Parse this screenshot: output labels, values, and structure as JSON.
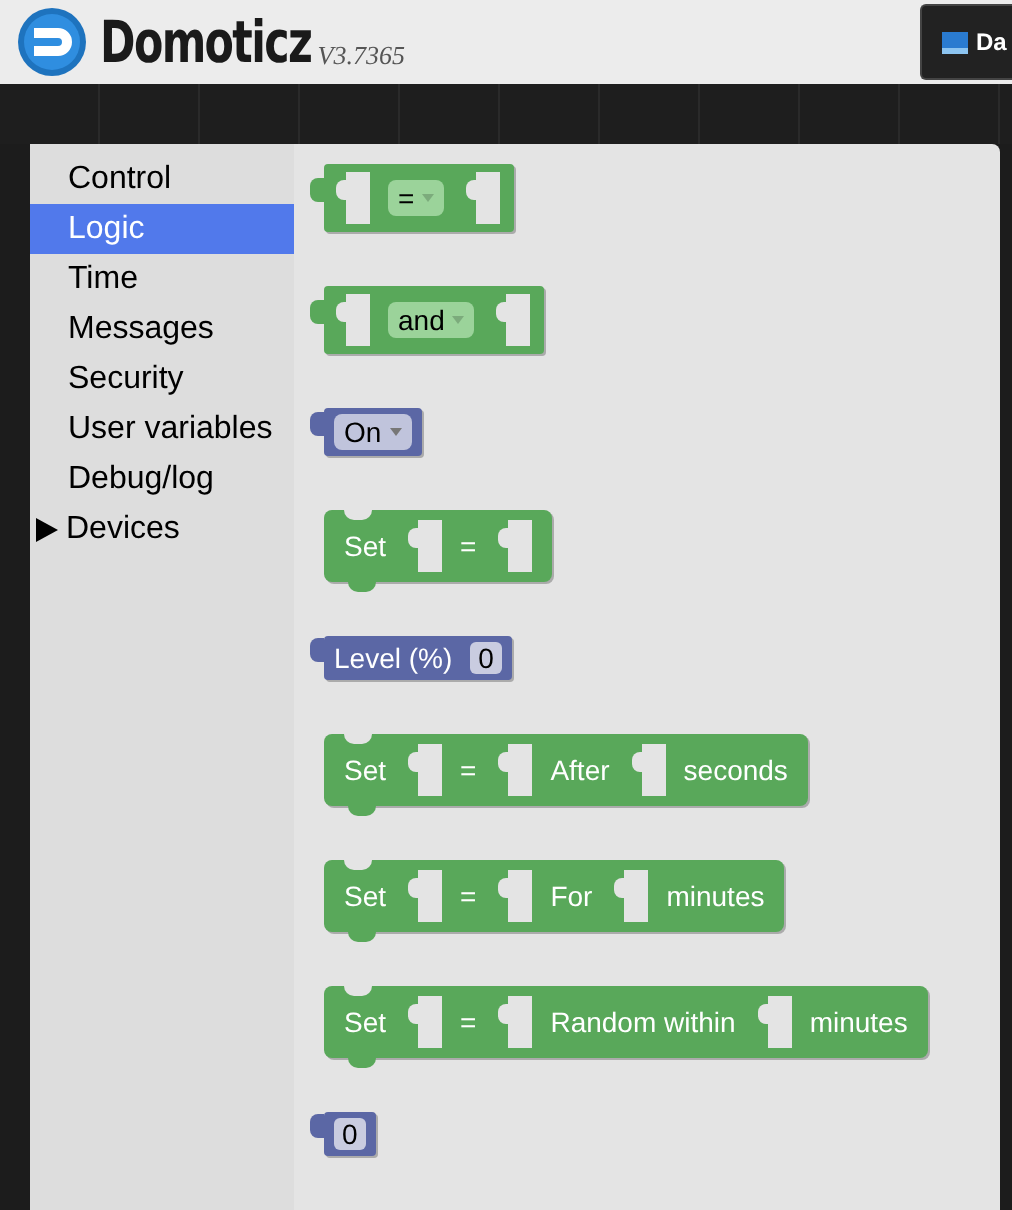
{
  "header": {
    "brand": "Domoticz",
    "version": "V3.7365",
    "nav_button": "Da"
  },
  "sidebar": {
    "items": [
      {
        "label": "Control",
        "selected": false,
        "kind": "category"
      },
      {
        "label": "Logic",
        "selected": true,
        "kind": "category"
      },
      {
        "label": "Time",
        "selected": false,
        "kind": "category"
      },
      {
        "label": "Messages",
        "selected": false,
        "kind": "category"
      },
      {
        "label": "Security",
        "selected": false,
        "kind": "category"
      },
      {
        "label": "User variables",
        "selected": false,
        "kind": "category"
      },
      {
        "label": "Debug/log",
        "selected": false,
        "kind": "category"
      },
      {
        "label": "Devices",
        "selected": false,
        "kind": "folder",
        "expanded": false
      }
    ]
  },
  "flyout": {
    "blocks": [
      {
        "kind": "value",
        "color": "#59a85a",
        "parts": [
          {
            "kind": "slot"
          },
          {
            "kind": "dropdown",
            "text": "="
          },
          {
            "kind": "slot"
          }
        ]
      },
      {
        "kind": "value",
        "color": "#59a85a",
        "parts": [
          {
            "kind": "slot"
          },
          {
            "kind": "dropdown",
            "text": "and"
          },
          {
            "kind": "slot"
          }
        ]
      },
      {
        "kind": "value",
        "color": "#5b67a5",
        "parts": [
          {
            "kind": "dropdown",
            "text": "On"
          }
        ]
      },
      {
        "kind": "statement",
        "color": "#59a85a",
        "parts": [
          {
            "kind": "text",
            "text": "Set"
          },
          {
            "kind": "slot"
          },
          {
            "kind": "text",
            "text": "="
          },
          {
            "kind": "slot"
          }
        ]
      },
      {
        "kind": "value",
        "color": "#5b67a5",
        "parts": [
          {
            "kind": "text",
            "text": "Level (%)"
          },
          {
            "kind": "number",
            "text": "0"
          }
        ]
      },
      {
        "kind": "statement",
        "color": "#59a85a",
        "parts": [
          {
            "kind": "text",
            "text": "Set"
          },
          {
            "kind": "slot"
          },
          {
            "kind": "text",
            "text": "="
          },
          {
            "kind": "slot"
          },
          {
            "kind": "text",
            "text": "After"
          },
          {
            "kind": "slot"
          },
          {
            "kind": "text",
            "text": "seconds"
          }
        ]
      },
      {
        "kind": "statement",
        "color": "#59a85a",
        "parts": [
          {
            "kind": "text",
            "text": "Set"
          },
          {
            "kind": "slot"
          },
          {
            "kind": "text",
            "text": "="
          },
          {
            "kind": "slot"
          },
          {
            "kind": "text",
            "text": "For"
          },
          {
            "kind": "slot"
          },
          {
            "kind": "text",
            "text": "minutes"
          }
        ]
      },
      {
        "kind": "statement",
        "color": "#59a85a",
        "parts": [
          {
            "kind": "text",
            "text": "Set"
          },
          {
            "kind": "slot"
          },
          {
            "kind": "text",
            "text": "="
          },
          {
            "kind": "slot"
          },
          {
            "kind": "text",
            "text": "Random within"
          },
          {
            "kind": "slot"
          },
          {
            "kind": "text",
            "text": "minutes"
          }
        ]
      },
      {
        "kind": "value",
        "color": "#5b67a5",
        "parts": [
          {
            "kind": "number",
            "text": "0"
          }
        ]
      }
    ]
  }
}
